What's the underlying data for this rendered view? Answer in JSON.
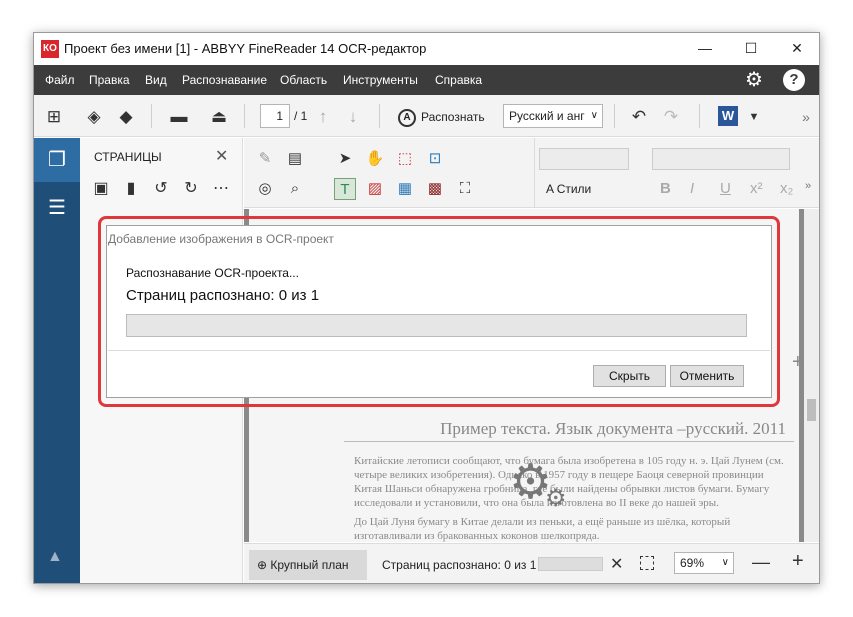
{
  "window": {
    "title": "Проект без имени [1] - ABBYY FineReader 14 OCR-редактор",
    "app_icon": "КО",
    "controls": {
      "minimize": "—",
      "maximize": "☐",
      "close": "✕"
    }
  },
  "menu": {
    "items": [
      "Файл",
      "Правка",
      "Вид",
      "Распознавание",
      "Область",
      "Инструменты",
      "Справка"
    ],
    "settings_icon": "⚙",
    "help_icon": "?"
  },
  "toolbar": {
    "current_page": "1",
    "total_pages": "/ 1",
    "recognize_label": "Распознать",
    "recognize_icon": "A",
    "language": "Русский и анг",
    "word_label": "W",
    "more": "»"
  },
  "pages_panel": {
    "title": "СТРАНИЦЫ",
    "close": "✕"
  },
  "text_toolbar": {
    "styles_label": "Стили",
    "styles_icon": "A",
    "bold": "B",
    "italic": "I",
    "underline": "U",
    "superscript": "x²",
    "subscript": "x₂",
    "more": "»"
  },
  "document": {
    "heading": "Пример текста. Язык документа –русский. 2011",
    "paragraph_1": "Китайские летописи сообщают, что бумага была изобретена в 105 году н. э. Цай Лунем (см. четыре великих изобретения). Однако в 1957 году в пещере Баоця северной провинции Китая Шаньси обнаружена гробница, где были найдены обрывки листов бумаги. Бумагу исследовали и установили, что она была изготовлена во II веке до нашей эры.",
    "paragraph_2": "До Цай Луня бумагу в Китае делали из пеньки, а ещё раньше из шёлка, который изготавливали из бракованных коконов шелкопряда."
  },
  "statusbar": {
    "zoom_button": "Крупный план",
    "status": "Страниц распознано: 0 из 1",
    "zoom": "69%",
    "minus": "—",
    "plus": "+"
  },
  "dialog": {
    "title": "Добавление изображения в OCR-проект",
    "status": "Распознавание OCR-проекта...",
    "pages": "Страниц распознано: 0 из 1",
    "progress": 0,
    "hide_label": "Скрыть",
    "cancel_label": "Отменить"
  },
  "colors": {
    "menubar": "#3c3c3c",
    "sidebar": "#1f4e79",
    "highlight": "#e0363c",
    "app_icon": "#d8262c",
    "word_icon": "#2b579a"
  }
}
